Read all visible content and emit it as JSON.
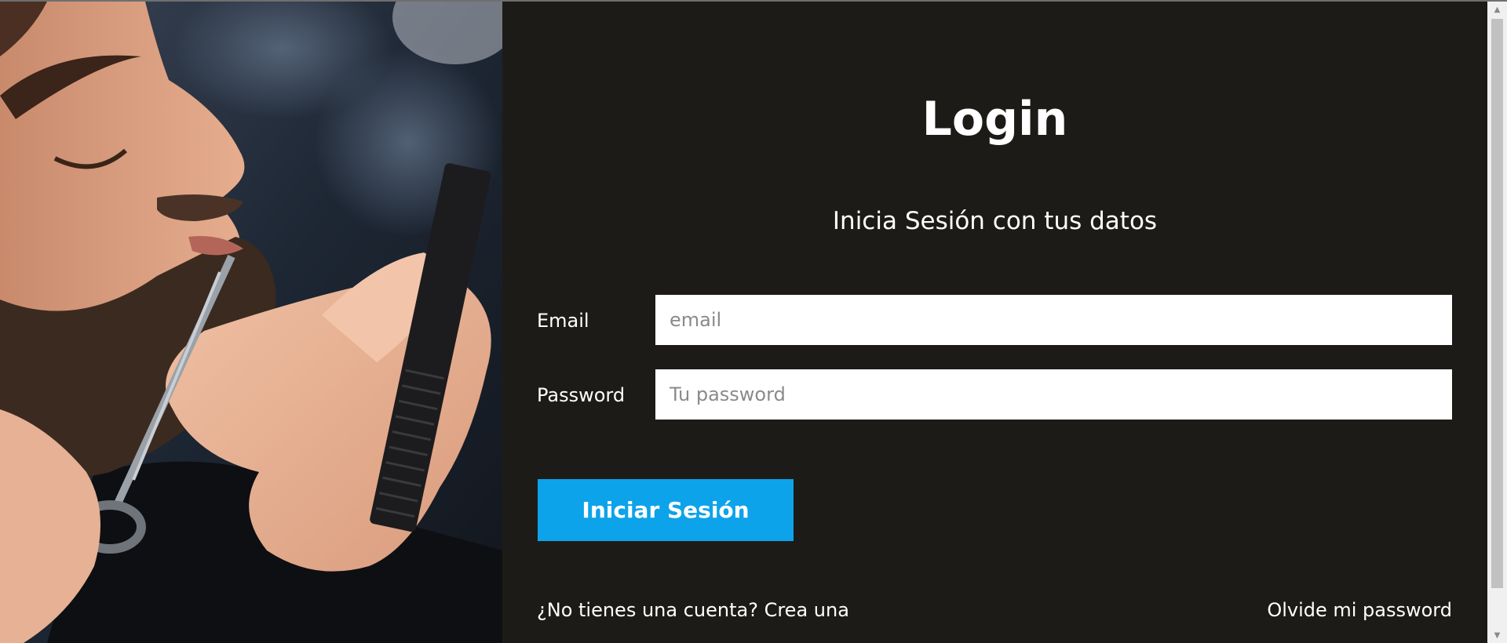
{
  "photo": {
    "description_icon": "barber-photo"
  },
  "login": {
    "title": "Login",
    "subtitle": "Inicia Sesión con tus datos",
    "email_label": "Email",
    "email_placeholder": "email",
    "email_value": "",
    "password_label": "Password",
    "password_placeholder": "Tu password",
    "password_value": "",
    "submit_label": "Iniciar Sesión",
    "signup_link": "¿No tienes una cuenta? Crea una",
    "forgot_link": "Olvide mi password"
  },
  "colors": {
    "panel_bg": "#1c1b17",
    "accent": "#0da3ea",
    "input_bg": "#ffffff",
    "text": "#ffffff"
  },
  "scrollbar": {
    "up_icon": "triangle-up-icon",
    "down_icon": "triangle-down-icon"
  }
}
